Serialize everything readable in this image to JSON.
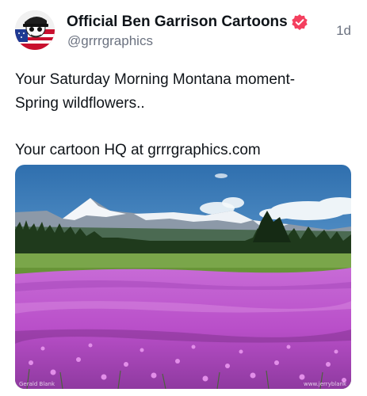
{
  "post": {
    "author": {
      "display_name": "Official  Ben Garrison Cartoons",
      "handle": "@grrrgraphics",
      "verified_icon": "verified-badge-icon",
      "verified_color": "#f43f5e"
    },
    "timestamp": "1d",
    "text_lines": [
      "Your Saturday Morning Montana moment-",
      "Spring wildflowers..",
      "Your cartoon HQ at grrrgraphics.com"
    ],
    "media": {
      "credit_left": "Gerald Blank",
      "credit_right": "www.jerryblank"
    }
  }
}
